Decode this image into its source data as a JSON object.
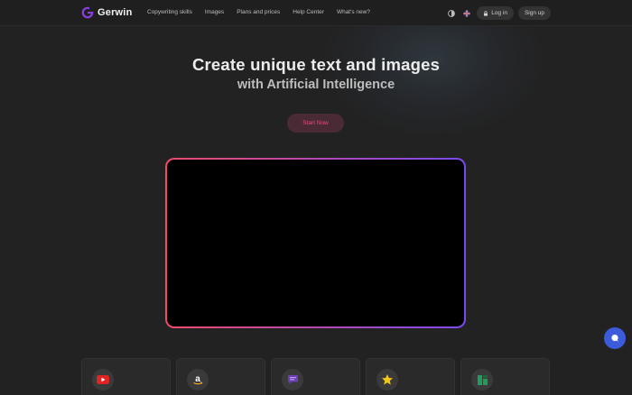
{
  "brand": {
    "name": "Gerwin",
    "accent": "#8b3ee0"
  },
  "nav": {
    "links": [
      "Copywriting skills",
      "Images",
      "Plans and prices",
      "Help Center",
      "What's new?"
    ],
    "login_label": "Log in",
    "signup_label": "Sign up"
  },
  "hero": {
    "title": "Create unique text and images",
    "subtitle": "with Artificial Intelligence",
    "cta_label": "Start Now"
  },
  "integrations": [
    {
      "icon": "youtube-icon",
      "color": "#e02424"
    },
    {
      "icon": "amazon-icon",
      "color": "#f5a623"
    },
    {
      "icon": "chat-bubble-icon",
      "color": "#6b3fb5"
    },
    {
      "icon": "star-icon",
      "color": "#f5c518"
    },
    {
      "icon": "sheets-icon",
      "color": "#1e9e5a"
    }
  ],
  "colors": {
    "background": "#222222",
    "cta_bg": "#4a2a35",
    "cta_text": "#e0507a",
    "frame_gradient_start": "#f04a6a",
    "frame_gradient_end": "#7a4af0",
    "chat_button": "#3b5bdb"
  }
}
